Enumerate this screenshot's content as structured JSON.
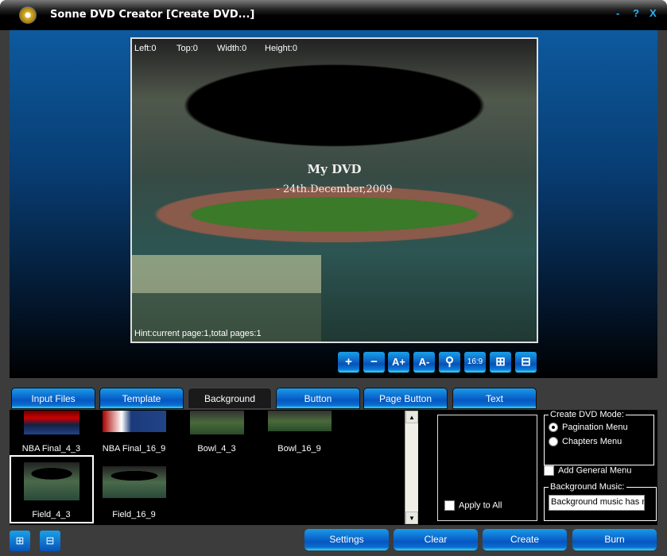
{
  "window": {
    "title": "Sonne DVD Creator [Create DVD...]",
    "minimize": "-",
    "help": "?",
    "close": "X"
  },
  "preview": {
    "left": "Left:0",
    "top": "Top:0",
    "width": "Width:0",
    "height": "Height:0",
    "dvd_title": "My DVD",
    "dvd_date": "- 24th.December,2009",
    "hint": "Hint:current page:1,total pages:1"
  },
  "toolbar": {
    "add": "+",
    "remove": "−",
    "font_larger": "A+",
    "font_smaller": "A-",
    "draw": "⚲",
    "aspect": "16:9",
    "zoom_in": "⊞",
    "zoom_out": "⊟"
  },
  "tabs": [
    "Input Files",
    "Template",
    "Background",
    "Button",
    "Page Button",
    "Text"
  ],
  "active_tab": "Background",
  "backgrounds": [
    "NBA Final_4_3",
    "NBA Final_16_9",
    "Bowl_4_3",
    "Bowl_16_9",
    "Field_4_3",
    "Field_16_9"
  ],
  "selected_background": "Field_4_3",
  "apply_to_all": "Apply to All",
  "mode": {
    "legend": "Create DVD Mode:",
    "pagination": "Pagination Menu",
    "chapters": "Chapters Menu",
    "selected": "Pagination Menu"
  },
  "add_general_menu": "Add General Menu",
  "music": {
    "legend": "Background Music:",
    "value": "Background music has not been set"
  },
  "buttons": {
    "settings": "Settings",
    "clear": "Clear",
    "create": "Create",
    "burn": "Burn"
  }
}
